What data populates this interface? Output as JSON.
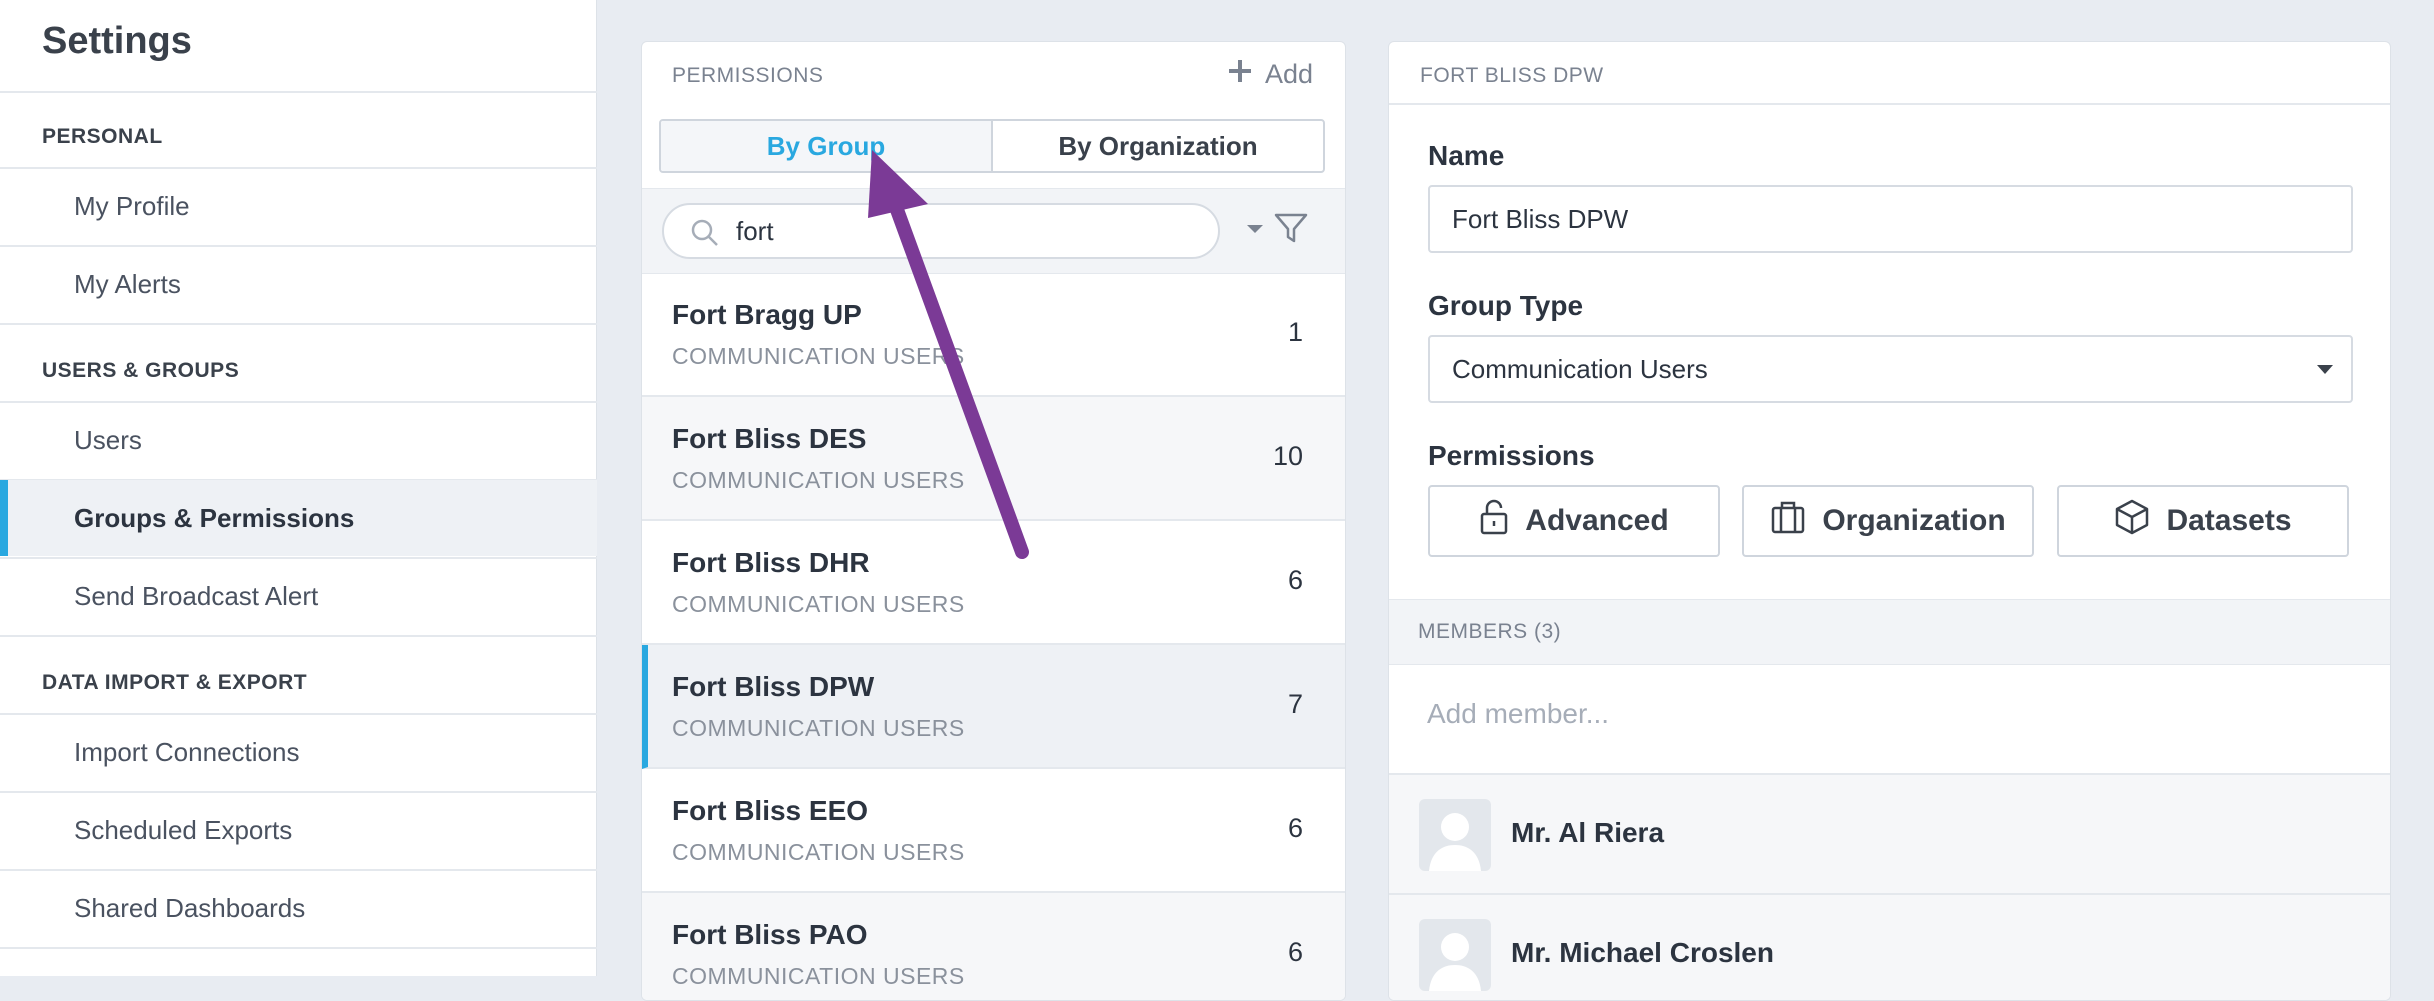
{
  "sidebar": {
    "title": "Settings",
    "sections": [
      {
        "label": "PERSONAL",
        "items": [
          "My Profile",
          "My Alerts"
        ]
      },
      {
        "label": "USERS & GROUPS",
        "items": [
          "Users",
          "Groups & Permissions",
          "Send Broadcast Alert"
        ]
      },
      {
        "label": "DATA IMPORT & EXPORT",
        "items": [
          "Import Connections",
          "Scheduled Exports",
          "Shared Dashboards"
        ]
      }
    ],
    "active_item": "Groups & Permissions"
  },
  "permissions_panel": {
    "header": "PERMISSIONS",
    "add_label": "Add",
    "tabs": [
      "By Group",
      "By Organization"
    ],
    "active_tab": "By Group",
    "search_value": "fort",
    "groups": [
      {
        "name": "Fort Bragg UP",
        "type": "COMMUNICATION USERS",
        "count": "1"
      },
      {
        "name": "Fort Bliss DES",
        "type": "COMMUNICATION USERS",
        "count": "10"
      },
      {
        "name": "Fort Bliss DHR",
        "type": "COMMUNICATION USERS",
        "count": "6"
      },
      {
        "name": "Fort Bliss DPW",
        "type": "COMMUNICATION USERS",
        "count": "7"
      },
      {
        "name": "Fort Bliss EEO",
        "type": "COMMUNICATION USERS",
        "count": "6"
      },
      {
        "name": "Fort Bliss PAO",
        "type": "COMMUNICATION USERS",
        "count": "6"
      }
    ],
    "selected_group": "Fort Bliss DPW"
  },
  "detail_panel": {
    "header": "FORT BLISS DPW",
    "name_label": "Name",
    "name_value": "Fort Bliss DPW",
    "group_type_label": "Group Type",
    "group_type_value": "Communication Users",
    "permissions_label": "Permissions",
    "permission_buttons": [
      "Advanced",
      "Organization",
      "Datasets"
    ],
    "members_header": "MEMBERS (3)",
    "add_member_placeholder": "Add member...",
    "members": [
      "Mr. Al Riera",
      "Mr. Michael Croslen"
    ]
  },
  "colors": {
    "accent": "#29a8e0",
    "annotation_arrow": "#7b3a96"
  },
  "icons": {
    "add": "plus-icon",
    "search": "search-icon",
    "filter": "filter-icon",
    "advanced": "lock-icon",
    "organization": "briefcase-icon",
    "datasets": "cube-icon",
    "avatar": "person-silhouette"
  }
}
